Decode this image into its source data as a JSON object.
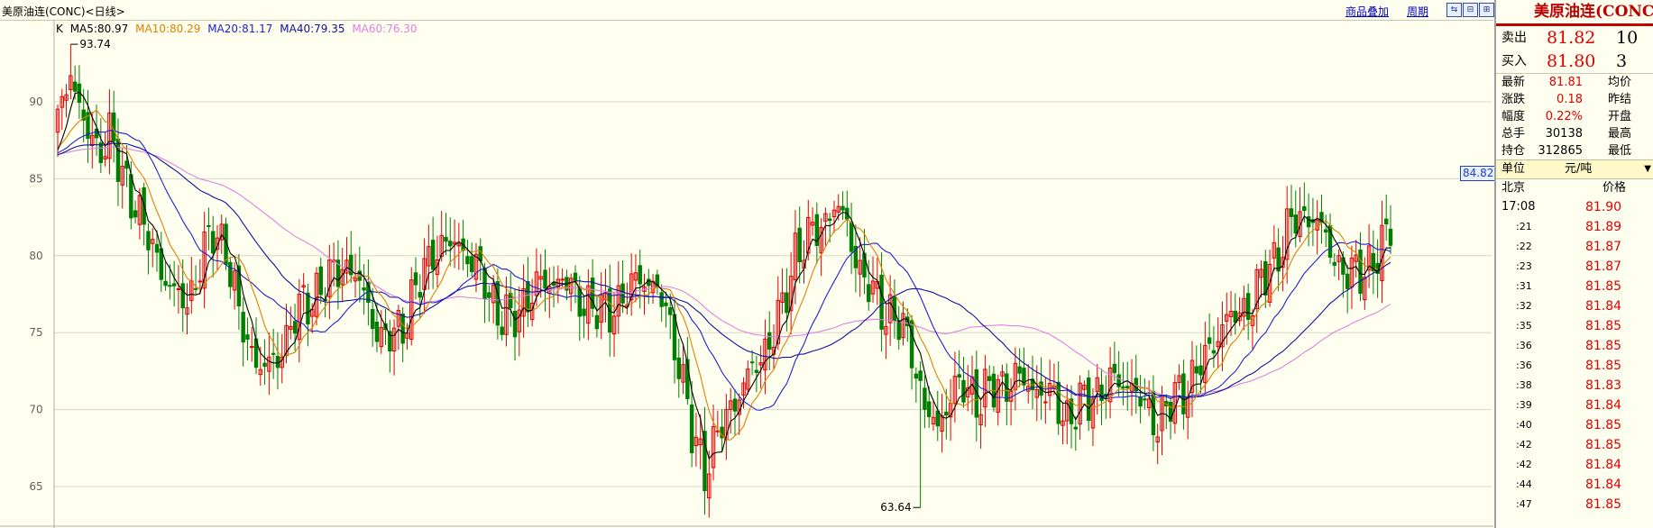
{
  "header": {
    "title": "美原油连(CONC)<日线>",
    "overlay_link": "商品叠加",
    "period_link": "周期",
    "nav_buttons": [
      "⇆",
      "⊟",
      "⊞"
    ]
  },
  "legend": {
    "k_label": "K",
    "ma5": "MA5:80.97",
    "ma10": "MA10:80.29",
    "ma20": "MA20:81.17",
    "ma40": "MA40:79.35",
    "ma60": "MA60:76.30"
  },
  "colors": {
    "up": "#E00000",
    "down": "#007F00",
    "ma5": "#000000",
    "ma10": "#E08000",
    "ma20": "#2020D0",
    "ma40": "#1010A0",
    "ma60": "#E080E0",
    "grid": "#D8D8C8"
  },
  "price_tag": "84.82",
  "chart_data": {
    "type": "candlestick",
    "title": "美原油连(CONC)<日线>",
    "ylim": [
      62,
      96
    ],
    "y_ticks": [
      65,
      70,
      75,
      80,
      85,
      90
    ],
    "high_annotation": "93.74",
    "low_annotation": "63.64",
    "anchors": [
      [
        0,
        88.5
      ],
      [
        3,
        92.2
      ],
      [
        6,
        88.5
      ],
      [
        9,
        86.8
      ],
      [
        12,
        88.0
      ],
      [
        15,
        85.0
      ],
      [
        18,
        83.5
      ],
      [
        21,
        81.0
      ],
      [
        24,
        79.2
      ],
      [
        27,
        77.5
      ],
      [
        30,
        76.8
      ],
      [
        33,
        79.5
      ],
      [
        36,
        81.5
      ],
      [
        39,
        80.6
      ],
      [
        42,
        76.0
      ],
      [
        45,
        73.8
      ],
      [
        48,
        72.5
      ],
      [
        51,
        73.4
      ],
      [
        54,
        75.5
      ],
      [
        57,
        76.8
      ],
      [
        60,
        77.6
      ],
      [
        63,
        78.4
      ],
      [
        66,
        79.6
      ],
      [
        69,
        78.6
      ],
      [
        72,
        76.8
      ],
      [
        75,
        74.5
      ],
      [
        78,
        74.8
      ],
      [
        81,
        76.2
      ],
      [
        84,
        78.4
      ],
      [
        87,
        80.4
      ],
      [
        90,
        80.6
      ],
      [
        93,
        80.8
      ],
      [
        96,
        79.6
      ],
      [
        99,
        78.2
      ],
      [
        102,
        76.4
      ],
      [
        105,
        75.6
      ],
      [
        108,
        77.0
      ],
      [
        111,
        77.9
      ],
      [
        114,
        78.3
      ],
      [
        117,
        78.5
      ],
      [
        120,
        77.4
      ],
      [
        123,
        76.9
      ],
      [
        126,
        76.2
      ],
      [
        129,
        76.8
      ],
      [
        132,
        77.4
      ],
      [
        135,
        78.8
      ],
      [
        138,
        78.0
      ],
      [
        141,
        76.5
      ],
      [
        144,
        73.2
      ],
      [
        147,
        68.4
      ],
      [
        150,
        66.2
      ],
      [
        153,
        68.2
      ],
      [
        156,
        70.2
      ],
      [
        159,
        71.6
      ],
      [
        162,
        72.9
      ],
      [
        165,
        74.5
      ],
      [
        168,
        76.4
      ],
      [
        171,
        80.3
      ],
      [
        174,
        81.0
      ],
      [
        177,
        82.0
      ],
      [
        180,
        83.2
      ],
      [
        183,
        82.0
      ],
      [
        186,
        79.0
      ],
      [
        189,
        77.4
      ],
      [
        192,
        76.4
      ],
      [
        195,
        75.6
      ],
      [
        198,
        74.0
      ],
      [
        201,
        70.0
      ],
      [
        204,
        68.7
      ],
      [
        207,
        71.2
      ],
      [
        210,
        71.4
      ],
      [
        213,
        70.8
      ],
      [
        216,
        71.2
      ],
      [
        219,
        71.6
      ],
      [
        222,
        72.1
      ],
      [
        225,
        71.5
      ],
      [
        228,
        71.3
      ],
      [
        231,
        70.5
      ],
      [
        234,
        69.5
      ],
      [
        237,
        70.2
      ],
      [
        240,
        71.0
      ],
      [
        243,
        71.5
      ],
      [
        246,
        71.9
      ],
      [
        249,
        71.6
      ],
      [
        252,
        70.0
      ],
      [
        255,
        69.3
      ],
      [
        258,
        70.4
      ],
      [
        261,
        71.3
      ],
      [
        264,
        72.4
      ],
      [
        267,
        73.8
      ],
      [
        270,
        75.6
      ],
      [
        273,
        76.0
      ],
      [
        276,
        76.8
      ],
      [
        279,
        78.2
      ],
      [
        282,
        79.7
      ],
      [
        285,
        81.6
      ],
      [
        288,
        82.6
      ],
      [
        291,
        82.6
      ],
      [
        294,
        81.0
      ],
      [
        297,
        79.4
      ],
      [
        300,
        78.6
      ],
      [
        303,
        79.2
      ],
      [
        306,
        79.9
      ],
      [
        309,
        81.8
      ]
    ]
  },
  "quote": {
    "title": "美原油连(CONC)",
    "sell_label": "卖出",
    "sell_price": "81.82",
    "sell_qty": "10",
    "buy_label": "买入",
    "buy_price": "81.80",
    "buy_qty": "3",
    "rows": [
      {
        "label": "最新",
        "value": "81.81",
        "label2": "均价",
        "red": true
      },
      {
        "label": "涨跌",
        "value": "0.18",
        "label2": "昨结",
        "red": true
      },
      {
        "label": "幅度",
        "value": "0.22%",
        "label2": "开盘",
        "red": true
      },
      {
        "label": "总手",
        "value": "30138",
        "label2": "最高",
        "red": false
      },
      {
        "label": "持仓",
        "value": "312865",
        "label2": "最低",
        "red": false
      }
    ],
    "unit_label": "单位",
    "unit_value": "元/吨",
    "ticks_head_left": "北京",
    "ticks_head_right": "价格",
    "ticks": [
      {
        "time": "17:08",
        "price": "81.90"
      },
      {
        "time": ":21",
        "price": "81.89"
      },
      {
        "time": ":22",
        "price": "81.87"
      },
      {
        "time": ":23",
        "price": "81.87"
      },
      {
        "time": ":31",
        "price": "81.85"
      },
      {
        "time": ":32",
        "price": "81.84"
      },
      {
        "time": ":35",
        "price": "81.85"
      },
      {
        "time": ":36",
        "price": "81.85"
      },
      {
        "time": ":36",
        "price": "81.85"
      },
      {
        "time": ":38",
        "price": "81.83"
      },
      {
        "time": ":39",
        "price": "81.84"
      },
      {
        "time": ":40",
        "price": "81.85"
      },
      {
        "time": ":42",
        "price": "81.85"
      },
      {
        "time": ":42",
        "price": "81.84"
      },
      {
        "time": ":44",
        "price": "81.84"
      },
      {
        "time": ":47",
        "price": "81.85"
      }
    ]
  }
}
